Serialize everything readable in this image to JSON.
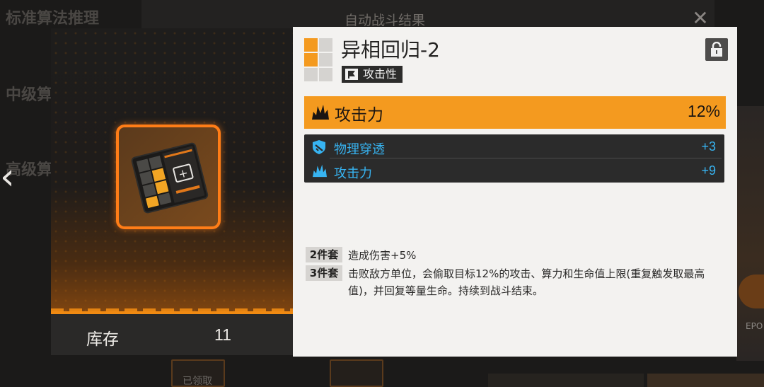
{
  "background": {
    "sidebar_items": [
      "标准算法推理",
      "中级算",
      "高级算"
    ],
    "window_title": "自动战斗结果",
    "right_badge": "EPO",
    "bottom_button": "已领取"
  },
  "item": {
    "stock_label": "库存",
    "stock_value": "11"
  },
  "detail": {
    "title": "异相回归-2",
    "type_tag": "攻击性",
    "main_stat": {
      "label": "攻击力",
      "value": "12%"
    },
    "sub_stats": [
      {
        "label": "物理穿透",
        "value": "+3"
      },
      {
        "label": "攻击力",
        "value": "+9"
      }
    ],
    "set_effects": [
      {
        "tag": "2件套",
        "text": "造成伤害+5%"
      },
      {
        "tag": "3件套",
        "text": "击败敌方单位，会偷取目标12%的攻击、算力和生命值上限(重复触发取最高值)，并回复等量生命。持续到战斗结束。"
      }
    ]
  },
  "colors": {
    "accent_orange": "#f49a1f",
    "frame_orange": "#ff7d17",
    "sub_stat_blue": "#37b4f2",
    "panel_bg": "#f3f2f0"
  }
}
